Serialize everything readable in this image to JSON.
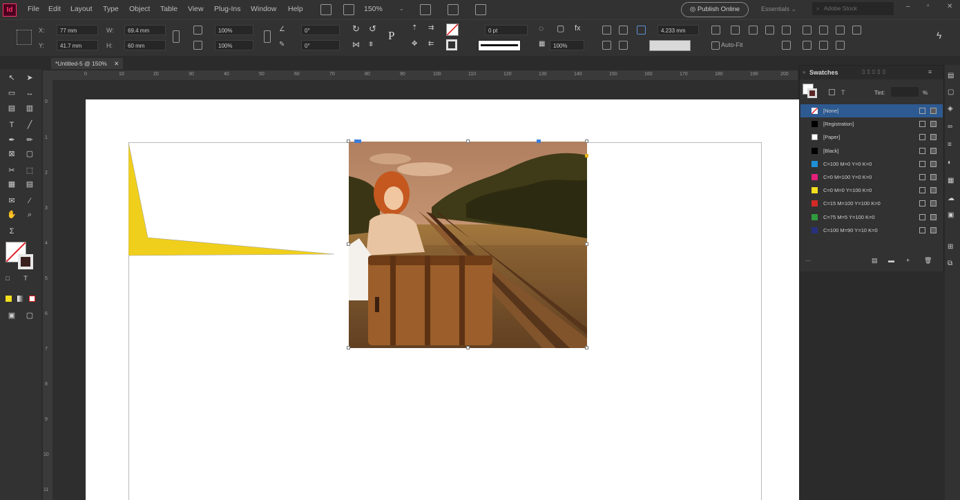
{
  "app": {
    "logo_text": "Id"
  },
  "menubar": {
    "items": [
      "File",
      "Edit",
      "Layout",
      "Type",
      "Object",
      "Table",
      "View",
      "Plug-Ins",
      "Window",
      "Help"
    ],
    "zoom": "150%",
    "publish_label": "Publish Online",
    "workspace": "Essentials",
    "stock_placeholder": "Adobe Stock"
  },
  "controlbar": {
    "x_label": "X:",
    "x_value": "77 mm",
    "y_label": "Y:",
    "y_value": "41.7 mm",
    "w_label": "W:",
    "w_value": "69.4 mm",
    "h_label": "H:",
    "h_value": "60 mm",
    "scale_x": "100%",
    "scale_y": "100%",
    "angle": "0°",
    "shear": "0°",
    "stroke_weight": "0 pt",
    "opacity": "100%",
    "offset": "4.233 mm",
    "autofit": "Auto-Fit"
  },
  "document": {
    "tab_title": "*Untitled-5 @ 150%"
  },
  "ruler": {
    "h_ticks": [
      "0",
      "10",
      "20",
      "30",
      "40",
      "50",
      "60",
      "70",
      "80",
      "90",
      "100",
      "110",
      "120",
      "130",
      "140",
      "150",
      "160",
      "170",
      "180",
      "190",
      "200"
    ],
    "v_ticks": [
      "0",
      "1",
      "2",
      "3",
      "4",
      "5",
      "6",
      "7",
      "8",
      "9",
      "10",
      "11",
      "12"
    ]
  },
  "shape": {
    "fill": "#f0cf1c"
  },
  "swatches": {
    "title": "Swatches",
    "tint_label": "Tint:",
    "percent": "%",
    "items": [
      {
        "name": "[None]",
        "color": "none",
        "selected": true
      },
      {
        "name": "[Registration]",
        "color": "#000000",
        "selected": false
      },
      {
        "name": "[Paper]",
        "color": "#ffffff",
        "selected": false
      },
      {
        "name": "[Black]",
        "color": "#000000",
        "selected": false
      },
      {
        "name": "C=100 M=0 Y=0 K=0",
        "color": "#1e90d8",
        "selected": false
      },
      {
        "name": "C=0 M=100 Y=0 K=0",
        "color": "#e4207a",
        "selected": false
      },
      {
        "name": "C=0 M=0 Y=100 K=0",
        "color": "#f3df1f",
        "selected": false
      },
      {
        "name": "C=15 M=100 Y=100 K=0",
        "color": "#d42a27",
        "selected": false
      },
      {
        "name": "C=75 M=5 Y=100 K=0",
        "color": "#2f9a3e",
        "selected": false
      },
      {
        "name": "C=100 M=90 Y=10 K=0",
        "color": "#28317e",
        "selected": false
      }
    ]
  }
}
